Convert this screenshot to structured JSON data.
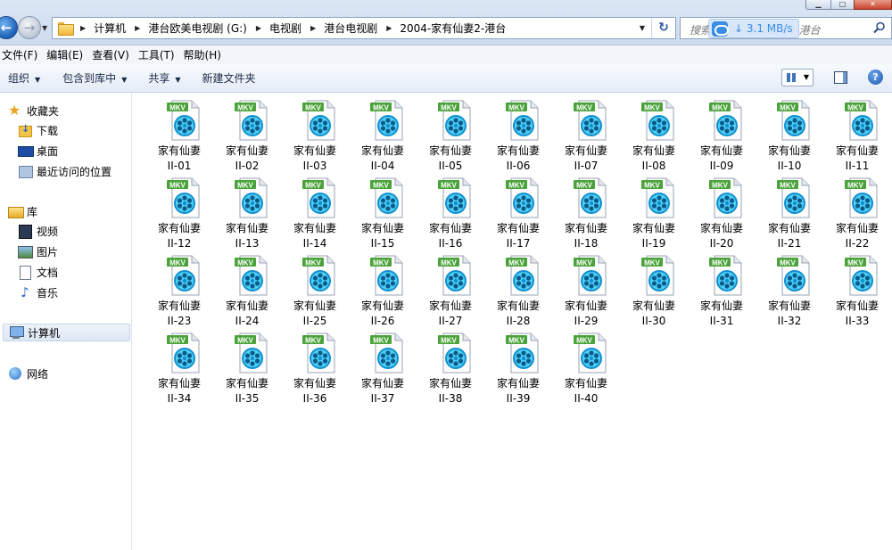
{
  "window": {
    "minimize_label": "▁",
    "maximize_label": "□",
    "close_label": "✕"
  },
  "address_bar": {
    "breadcrumbs": [
      "计算机",
      "港台欧美电视剧 (G:)",
      "电视剧",
      "港台电视剧",
      "2004-家有仙妻2-港台"
    ],
    "search_placeholder": "搜索 2004-家有仙妻2-港台",
    "download_speed": "↓ 3.1 MB/s"
  },
  "menu": [
    "文件(F)",
    "编辑(E)",
    "查看(V)",
    "工具(T)",
    "帮助(H)"
  ],
  "toolbar": {
    "organize": "组织",
    "include_in_library": "包含到库中",
    "share": "共享",
    "new_folder": "新建文件夹",
    "help": "?"
  },
  "nav": {
    "favorites": "收藏夹",
    "downloads": "下载",
    "desktop": "桌面",
    "recent": "最近访问的位置",
    "libraries": "库",
    "videos": "视频",
    "pictures": "图片",
    "documents": "文档",
    "music": "音乐",
    "computer": "计算机",
    "network": "网络"
  },
  "file_badge": "MKV",
  "files": [
    {
      "line1": "家有仙妻",
      "line2": "II-01"
    },
    {
      "line1": "家有仙妻",
      "line2": "II-02"
    },
    {
      "line1": "家有仙妻",
      "line2": "II-03"
    },
    {
      "line1": "家有仙妻",
      "line2": "II-04"
    },
    {
      "line1": "家有仙妻",
      "line2": "II-05"
    },
    {
      "line1": "家有仙妻",
      "line2": "II-06"
    },
    {
      "line1": "家有仙妻",
      "line2": "II-07"
    },
    {
      "line1": "家有仙妻",
      "line2": "II-08"
    },
    {
      "line1": "家有仙妻",
      "line2": "II-09"
    },
    {
      "line1": "家有仙妻",
      "line2": "II-10"
    },
    {
      "line1": "家有仙妻",
      "line2": "II-11"
    },
    {
      "line1": "家有仙妻",
      "line2": "II-12"
    },
    {
      "line1": "家有仙妻",
      "line2": "II-13"
    },
    {
      "line1": "家有仙妻",
      "line2": "II-14"
    },
    {
      "line1": "家有仙妻",
      "line2": "II-15"
    },
    {
      "line1": "家有仙妻",
      "line2": "II-16"
    },
    {
      "line1": "家有仙妻",
      "line2": "II-17"
    },
    {
      "line1": "家有仙妻",
      "line2": "II-18"
    },
    {
      "line1": "家有仙妻",
      "line2": "II-19"
    },
    {
      "line1": "家有仙妻",
      "line2": "II-20"
    },
    {
      "line1": "家有仙妻",
      "line2": "II-21"
    },
    {
      "line1": "家有仙妻",
      "line2": "II-22"
    },
    {
      "line1": "家有仙妻",
      "line2": "II-23"
    },
    {
      "line1": "家有仙妻",
      "line2": "II-24"
    },
    {
      "line1": "家有仙妻",
      "line2": "II-25"
    },
    {
      "line1": "家有仙妻",
      "line2": "II-26"
    },
    {
      "line1": "家有仙妻",
      "line2": "II-27"
    },
    {
      "line1": "家有仙妻",
      "line2": "II-28"
    },
    {
      "line1": "家有仙妻",
      "line2": "II-29"
    },
    {
      "line1": "家有仙妻",
      "line2": "II-30"
    },
    {
      "line1": "家有仙妻",
      "line2": "II-31"
    },
    {
      "line1": "家有仙妻",
      "line2": "II-32"
    },
    {
      "line1": "家有仙妻",
      "line2": "II-33"
    },
    {
      "line1": "家有仙妻",
      "line2": "II-34"
    },
    {
      "line1": "家有仙妻",
      "line2": "II-35"
    },
    {
      "line1": "家有仙妻",
      "line2": "II-36"
    },
    {
      "line1": "家有仙妻",
      "line2": "II-37"
    },
    {
      "line1": "家有仙妻",
      "line2": "II-38"
    },
    {
      "line1": "家有仙妻",
      "line2": "II-39"
    },
    {
      "line1": "家有仙妻",
      "line2": "II-40"
    }
  ],
  "colors": {
    "mkv_badge": "#4aa33a",
    "reel_outer": "#0f8fcf",
    "reel_inner": "#4fd0f5",
    "accent": "#3a8ee8"
  }
}
